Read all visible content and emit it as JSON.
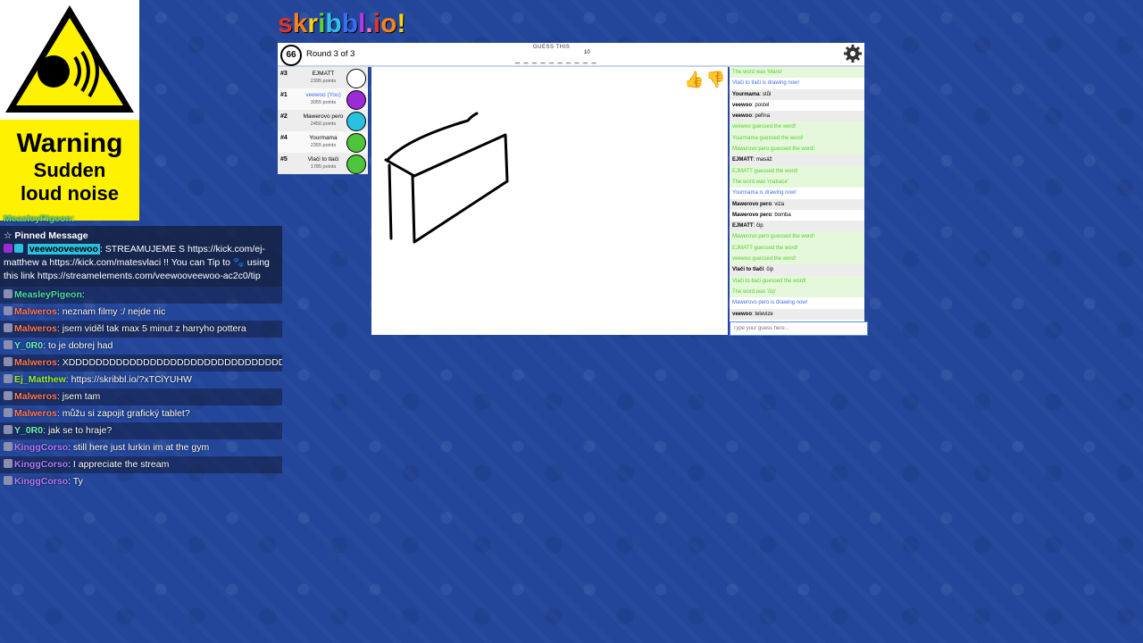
{
  "warning": {
    "title": "Warning",
    "line1": "Sudden",
    "line2": "loud noise"
  },
  "chat": {
    "top_partial": "MeasleyPigeon:",
    "pinned_title": "Pinned Message",
    "pinned_user": "veewooveewoo",
    "pinned_text": "STREAMUJEME S https://kick.com/ej-matthew a https://kick.com/matesvlaci !! You can Tip to",
    "pinned_text2": "using this link https://streamelements.com/veewooveewoo-ac2c0/tip",
    "lines": [
      {
        "user": "MeasleyPigeon",
        "color": "#4ce0a4",
        "text": ""
      },
      {
        "user": "Malweros",
        "color": "#ff7a5c",
        "text": "neznam filmy :/ nejde nic"
      },
      {
        "user": "Malweros",
        "color": "#ff7a5c",
        "text": "jsem viděl tak max 5 minut z harryho pottera"
      },
      {
        "user": "Y_0R0",
        "color": "#6cf5c0",
        "text": "to je dobrej had"
      },
      {
        "user": "Malweros",
        "color": "#ff7a5c",
        "text": "XDDDDDDDDDDDDDDDDDDDDDDDDDDDDDDDDDDD"
      },
      {
        "user": "Ej_Matthew",
        "color": "#9cf53a",
        "text": "https://skribbl.io/?xTCiYUHW"
      },
      {
        "user": "Malweros",
        "color": "#ff7a5c",
        "text": "jsem tam"
      },
      {
        "user": "Malweros",
        "color": "#ff7a5c",
        "text": "můžu si zapojit grafický tablet?"
      },
      {
        "user": "Y_0R0",
        "color": "#6cf5c0",
        "text": "jak se to hraje?"
      },
      {
        "user": "KinggCorso",
        "color": "#b27cff",
        "text": "still here just lurkin im at the gym"
      },
      {
        "user": "KinggCorso",
        "color": "#b27cff",
        "text": "I appreciate the stream"
      },
      {
        "user": "KinggCorso",
        "color": "#b27cff",
        "text": "Ty"
      }
    ]
  },
  "game": {
    "logo": [
      "s",
      "k",
      "r",
      "i",
      "b",
      "b",
      "l",
      ".",
      "i",
      "o",
      "!"
    ],
    "logo_colors": [
      "#e0342a",
      "#f5821f",
      "#f7d21c",
      "#5ed23c",
      "#31c0f0",
      "#3a6ef0",
      "#b33ae5",
      "#ff7ab0",
      "#e0342a",
      "#f5821f",
      "#f7d21c"
    ],
    "timer": "66",
    "round": "Round 3 of 3",
    "guess_label": "GUESS THIS",
    "blanks": "_ _ _ _ _ _ _ _ _ _",
    "word_length": "10",
    "players": [
      {
        "rank": "#3",
        "name": "EJMATT",
        "points": "2395 points",
        "me": false,
        "color": "#ffffff"
      },
      {
        "rank": "#1",
        "name": "veewoo (You)",
        "points": "3055 points",
        "me": true,
        "color": "#9b2bd6"
      },
      {
        "rank": "#2",
        "name": "Mawerovo pero",
        "points": "2450 points",
        "me": false,
        "color": "#2bbfe0"
      },
      {
        "rank": "#4",
        "name": "Yourmama",
        "points": "2355 points",
        "me": false,
        "color": "#4dc43a"
      },
      {
        "rank": "#5",
        "name": "Vlači to tlači",
        "points": "1785 points",
        "me": false,
        "color": "#4dc43a"
      }
    ],
    "messages": [
      {
        "type": "green",
        "text": "The word was 'Mario'"
      },
      {
        "type": "blue",
        "text": "Vlači to tlači is drawing now!"
      },
      {
        "type": "normal",
        "user": "Yourmama",
        "text": "stůl"
      },
      {
        "type": "normal",
        "user": "veewoo",
        "text": "postel"
      },
      {
        "type": "normal",
        "user": "veewoo",
        "text": "peřina"
      },
      {
        "type": "green",
        "text": "veewoo guessed the word!"
      },
      {
        "type": "green",
        "text": "Yourmama guessed the word!"
      },
      {
        "type": "green",
        "text": "Mawerovo pero guessed the word!"
      },
      {
        "type": "normal",
        "user": "EJMATT",
        "text": "masáž"
      },
      {
        "type": "green",
        "text": "EJMATT guessed the word!"
      },
      {
        "type": "green",
        "text": "The word was 'matrace'"
      },
      {
        "type": "blue",
        "text": "Yourmama is drawing now!"
      },
      {
        "type": "normal",
        "user": "Mawerovo pero",
        "text": "viza"
      },
      {
        "type": "normal",
        "user": "Mawerovo pero",
        "text": "bomba"
      },
      {
        "type": "normal",
        "user": "EJMATT",
        "text": "čip"
      },
      {
        "type": "green",
        "text": "Mawerovo pero guessed the word!"
      },
      {
        "type": "green",
        "text": "EJMATT guessed the word!"
      },
      {
        "type": "green",
        "text": "veewoo guessed the word!"
      },
      {
        "type": "normal",
        "user": "Vlači to tlači",
        "text": "čip"
      },
      {
        "type": "green",
        "text": "Vlači to tlači guessed the word!"
      },
      {
        "type": "green",
        "text": "The word was 'čip'"
      },
      {
        "type": "blue",
        "text": "Mawerovo pero is drawing now!"
      },
      {
        "type": "normal",
        "user": "veewoo",
        "text": "televize"
      }
    ],
    "input_placeholder": "Type your guess here..."
  }
}
